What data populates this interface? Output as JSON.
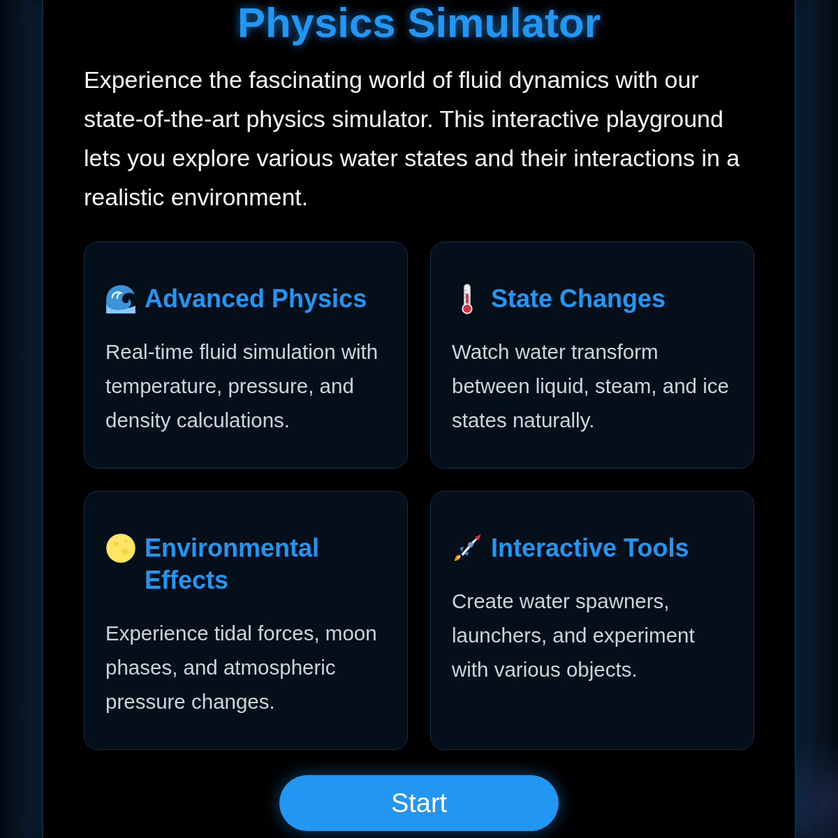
{
  "title": "Physics Simulator",
  "intro": "Experience the fascinating world of fluid dynamics with our state-of-the-art physics simulator. This interactive playground lets you explore various water states and their interactions in a realistic environment.",
  "features": [
    {
      "kind": "wave",
      "title": "Advanced Physics",
      "description": "Real-time fluid simulation with temperature, pressure, and density calculations."
    },
    {
      "kind": "thermometer",
      "title": "State Changes",
      "description": "Watch water transform between liquid, steam, and ice states naturally."
    },
    {
      "kind": "moon",
      "title": "Environmental Effects",
      "description": "Experience tidal forces, moon phases, and atmospheric pressure changes."
    },
    {
      "kind": "rocket",
      "title": "Interactive Tools",
      "description": "Create water spawners, launchers, and experiment with various objects."
    }
  ],
  "start_button": {
    "label": "Start"
  }
}
